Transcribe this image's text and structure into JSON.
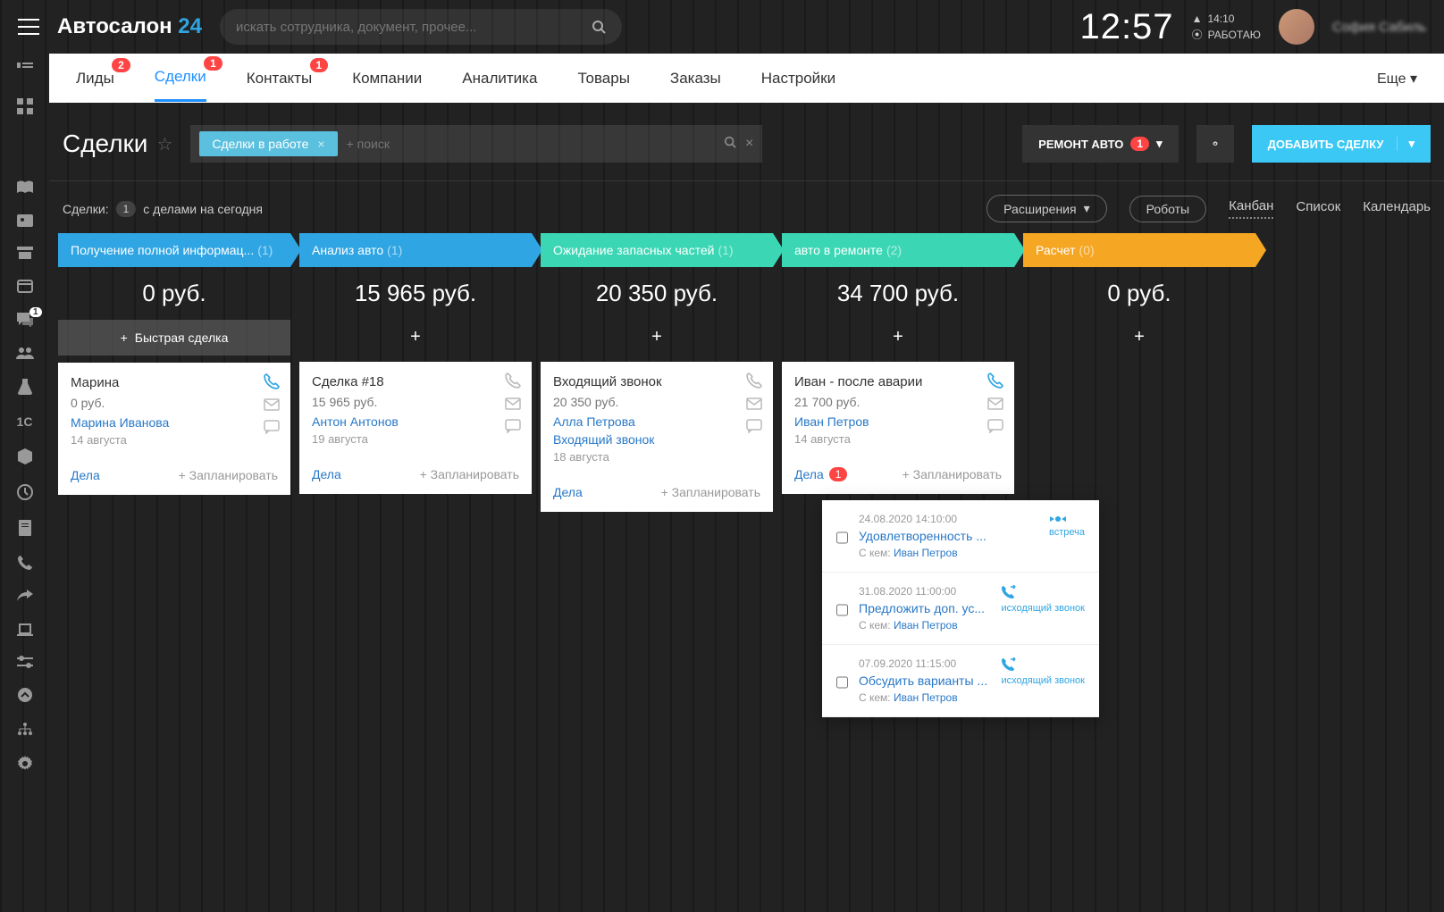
{
  "brand": {
    "name": "Автосалон",
    "suffix": "24"
  },
  "search": {
    "placeholder": "искать сотрудника, документ, прочее..."
  },
  "clock": {
    "time": "12:57",
    "sidetime": "14:10",
    "status": "РАБОТАЮ"
  },
  "user": {
    "name": "София Сабиль"
  },
  "nav": {
    "items": [
      {
        "label": "Лиды",
        "badge": "2"
      },
      {
        "label": "Сделки",
        "badge": "1",
        "active": true
      },
      {
        "label": "Контакты",
        "badge": "1"
      },
      {
        "label": "Компании"
      },
      {
        "label": "Аналитика"
      },
      {
        "label": "Товары"
      },
      {
        "label": "Заказы"
      },
      {
        "label": "Настройки"
      }
    ],
    "more": "Еще"
  },
  "leftRail": {
    "chatBadge": "1"
  },
  "page": {
    "title": "Сделки",
    "filterChip": "Сделки в работе",
    "filterPlaceholder": "+ поиск",
    "darkBtn": "РЕМОНТ АВТО",
    "darkBtnBadge": "1",
    "primaryBtn": "ДОБАВИТЬ СДЕЛКУ"
  },
  "subhead": {
    "label": "Сделки:",
    "count": "1",
    "tail": "с делами на сегодня",
    "ext": "Расширения",
    "robots": "Роботы",
    "views": {
      "kanban": "Канбан",
      "list": "Список",
      "calendar": "Календарь"
    }
  },
  "quickDeal": "Быстрая сделка",
  "planLabel": "+ Запланировать",
  "delaLabel": "Дела",
  "whoLabel": "С кем:",
  "columns": [
    {
      "title": "Получение полной информац...",
      "count": "(1)",
      "sum": "0 руб.",
      "color": "blue",
      "quick": true,
      "cards": [
        {
          "title": "Марина",
          "price": "0 руб.",
          "links": [
            "Марина Иванова"
          ],
          "date": "14 августа",
          "phoneActive": true
        }
      ]
    },
    {
      "title": "Анализ авто",
      "count": "(1)",
      "sum": "15 965 руб.",
      "color": "blue",
      "cards": [
        {
          "title": "Сделка #18",
          "price": "15 965 руб.",
          "links": [
            "Антон Антонов"
          ],
          "date": "19 августа"
        }
      ]
    },
    {
      "title": "Ожидание запасных частей",
      "count": "(1)",
      "sum": "20 350 руб.",
      "color": "teal",
      "cards": [
        {
          "title": "Входящий звонок",
          "price": "20 350 руб.",
          "links": [
            "Алла Петрова",
            "Входящий звонок"
          ],
          "date": "18 августа"
        }
      ]
    },
    {
      "title": "авто в ремонте",
      "count": "(2)",
      "sum": "34 700 руб.",
      "color": "teal",
      "cards": [
        {
          "title": "Иван - после аварии",
          "price": "21 700 руб.",
          "links": [
            "Иван Петров"
          ],
          "date": "14 августа",
          "phoneActive": true,
          "delaBadge": "1"
        }
      ]
    },
    {
      "title": "Расчет",
      "count": "(0)",
      "sum": "0 руб.",
      "color": "orange",
      "cards": []
    }
  ],
  "tasks": [
    {
      "date": "24.08.2020 14:10:00",
      "title": "Удовлетворенность ...",
      "who": "Иван Петров",
      "type": "встреча",
      "icon": "meet"
    },
    {
      "date": "31.08.2020 11:00:00",
      "title": "Предложить доп. ус...",
      "who": "Иван Петров",
      "type": "исходящий звонок",
      "icon": "call"
    },
    {
      "date": "07.09.2020 11:15:00",
      "title": "Обсудить варианты ...",
      "who": "Иван Петров",
      "type": "исходящий звонок",
      "icon": "call"
    }
  ]
}
